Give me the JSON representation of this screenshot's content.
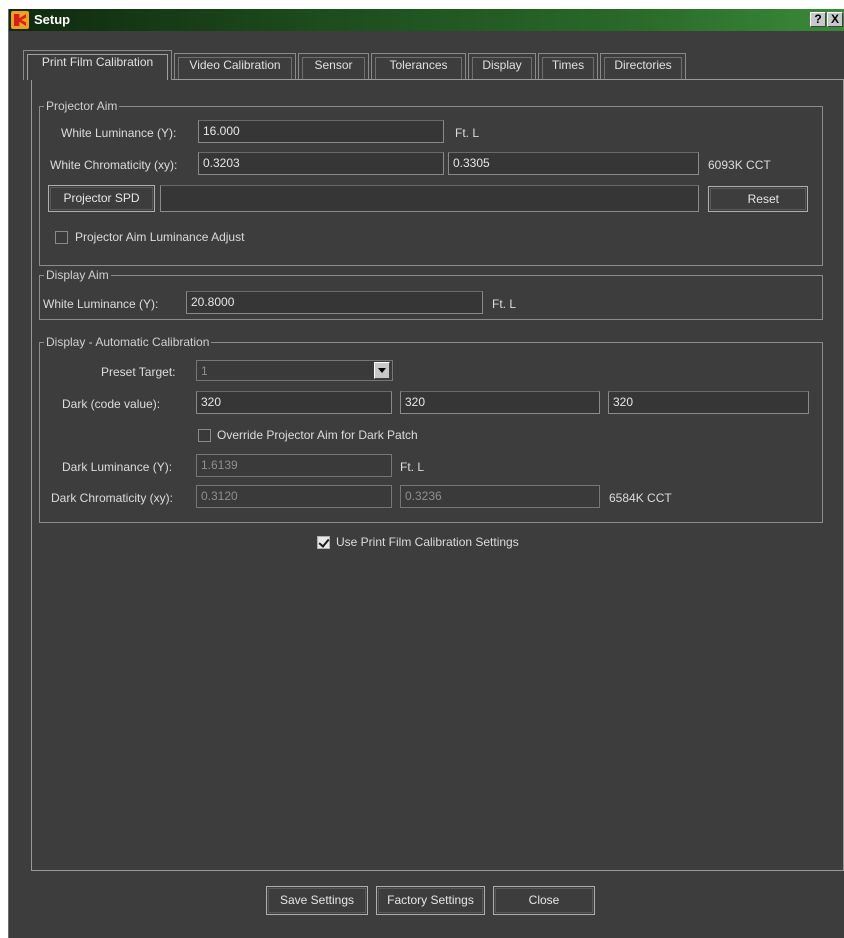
{
  "window": {
    "title": "Setup",
    "help_label": "?",
    "close_label": "X"
  },
  "tabs": [
    {
      "label": "Print Film Calibration"
    },
    {
      "label": "Video Calibration"
    },
    {
      "label": "Sensor"
    },
    {
      "label": "Tolerances"
    },
    {
      "label": "Display"
    },
    {
      "label": "Times"
    },
    {
      "label": "Directories"
    }
  ],
  "projector_aim": {
    "title": "Projector Aim",
    "white_luminance_label": "White Luminance (Y):",
    "white_luminance_value": "16.000",
    "white_luminance_unit": "Ft. L",
    "white_chromaticity_label": "White Chromaticity (xy):",
    "chroma_x": "0.3203",
    "chroma_y": "0.3305",
    "cct": "6093K CCT",
    "spd_button": "Projector SPD",
    "spd_value": "",
    "reset_button": "Reset",
    "luminance_adjust_label": "Projector Aim Luminance Adjust"
  },
  "display_aim": {
    "title": "Display Aim",
    "white_luminance_label": "White Luminance (Y):",
    "white_luminance_value": "20.8000",
    "unit": "Ft. L"
  },
  "auto_cal": {
    "title": "Display - Automatic Calibration",
    "preset_target_label": "Preset Target:",
    "preset_target_value": "1",
    "dark_code_label": "Dark (code value):",
    "dark_code_values": [
      "320",
      "320",
      "320"
    ],
    "override_label": "Override Projector Aim for Dark Patch",
    "dark_luminance_label": "Dark Luminance (Y):",
    "dark_luminance_value": "1.6139",
    "dark_luminance_unit": "Ft. L",
    "dark_chroma_label": "Dark Chromaticity (xy):",
    "dark_chroma_x": "0.3120",
    "dark_chroma_y": "0.3236",
    "dark_cct": "6584K CCT"
  },
  "use_print_film_label": "Use Print Film Calibration Settings",
  "footer": {
    "save": "Save Settings",
    "factory": "Factory Settings",
    "close": "Close"
  },
  "colors": {
    "title_bar": "#1c4a1c",
    "background": "#3d3d3d"
  }
}
